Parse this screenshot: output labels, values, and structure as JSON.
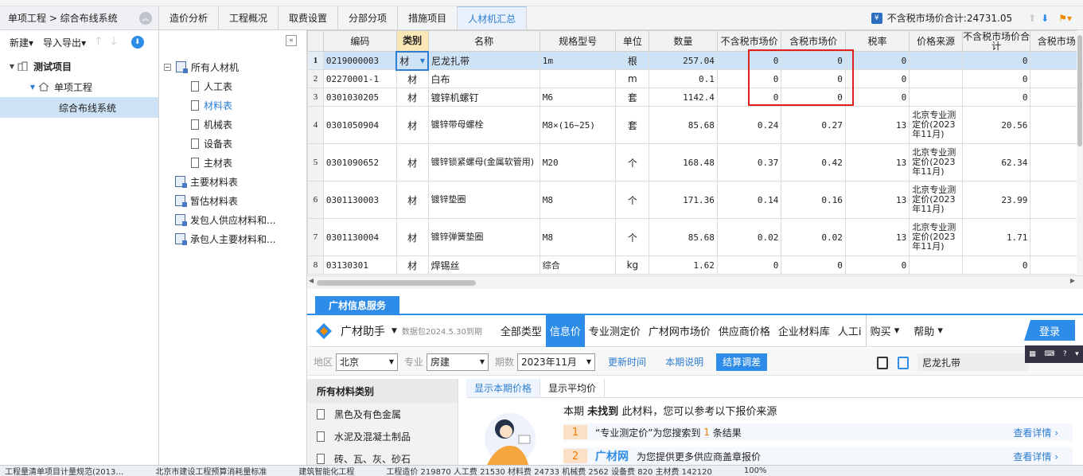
{
  "left_panel": {
    "title": "单项工程 > 综合布线系统",
    "new_label": "新建",
    "import_export_label": "导入导出",
    "tree": [
      {
        "label": "测试项目"
      },
      {
        "label": "单项工程"
      },
      {
        "label": "综合布线系统"
      }
    ]
  },
  "tabs": [
    "造价分析",
    "工程概况",
    "取费设置",
    "分部分项",
    "措施项目",
    "人材机汇总"
  ],
  "summary": "不含税市场价合计:24731.05",
  "mid_tree": [
    {
      "label": "所有人材机",
      "type": "folder"
    },
    {
      "label": "人工表",
      "type": "doc"
    },
    {
      "label": "材料表",
      "type": "doc",
      "selected": true
    },
    {
      "label": "机械表",
      "type": "doc"
    },
    {
      "label": "设备表",
      "type": "doc"
    },
    {
      "label": "主材表",
      "type": "doc"
    },
    {
      "label": "主要材料表",
      "type": "folder"
    },
    {
      "label": "暂估材料表",
      "type": "folder"
    },
    {
      "label": "发包人供应材料和...",
      "type": "folder"
    },
    {
      "label": "承包人主要材料和...",
      "type": "folder"
    }
  ],
  "grid": {
    "headers": [
      "编码",
      "类别",
      "名称",
      "规格型号",
      "单位",
      "数量",
      "不含税市场价",
      "含税市场价",
      "税率",
      "价格来源",
      "不含税市场价合计",
      "含税市场"
    ],
    "rows": [
      {
        "no": "1",
        "code": "0219000003",
        "cat": "材",
        "name": "尼龙扎带",
        "spec": "1m",
        "unit": "根",
        "qty": "257.04",
        "p_ex": "0",
        "p_in": "0",
        "tax": "0",
        "src": "",
        "total": "0"
      },
      {
        "no": "2",
        "code": "02270001-1",
        "cat": "材",
        "name": "白布",
        "spec": "",
        "unit": "m",
        "qty": "0.1",
        "p_ex": "0",
        "p_in": "0",
        "tax": "0",
        "src": "",
        "total": "0"
      },
      {
        "no": "3",
        "code": "0301030205",
        "cat": "材",
        "name": "镀锌机螺钉",
        "spec": "M6",
        "unit": "套",
        "qty": "1142.4",
        "p_ex": "0",
        "p_in": "0",
        "tax": "0",
        "src": "",
        "total": "0"
      },
      {
        "no": "4",
        "code": "0301050904",
        "cat": "材",
        "name": "镀锌带母螺栓",
        "spec": "M8×(16~25)",
        "unit": "套",
        "qty": "85.68",
        "p_ex": "0.24",
        "p_in": "0.27",
        "tax": "13",
        "src": "北京专业测定价(2023年11月)",
        "total": "20.56"
      },
      {
        "no": "5",
        "code": "0301090652",
        "cat": "材",
        "name": "镀锌锁紧螺母(金属软管用)",
        "spec": "M20",
        "unit": "个",
        "qty": "168.48",
        "p_ex": "0.37",
        "p_in": "0.42",
        "tax": "13",
        "src": "北京专业测定价(2023年11月)",
        "total": "62.34"
      },
      {
        "no": "6",
        "code": "0301130003",
        "cat": "材",
        "name": "镀锌垫圈",
        "spec": "M8",
        "unit": "个",
        "qty": "171.36",
        "p_ex": "0.14",
        "p_in": "0.16",
        "tax": "13",
        "src": "北京专业测定价(2023年11月)",
        "total": "23.99"
      },
      {
        "no": "7",
        "code": "0301130004",
        "cat": "材",
        "name": "镀锌弹簧垫圈",
        "spec": "M8",
        "unit": "个",
        "qty": "85.68",
        "p_ex": "0.02",
        "p_in": "0.02",
        "tax": "13",
        "src": "北京专业测定价(2023年11月)",
        "total": "1.71"
      },
      {
        "no": "8",
        "code": "03130301",
        "cat": "材",
        "name": "焊锡丝",
        "spec": "综合",
        "unit": "kg",
        "qty": "1.62",
        "p_ex": "0",
        "p_in": "0",
        "tax": "0",
        "src": "",
        "total": "0"
      }
    ]
  },
  "guangcai": {
    "tab": "广材信息服务",
    "title": "广材助手",
    "version": "数据包2024.5.30到期",
    "nav": [
      "全部类型",
      "信息价",
      "专业测定价",
      "广材网市场价",
      "供应商价格",
      "企业材料库",
      "人工i",
      "购买",
      "帮助"
    ],
    "login": "登录",
    "filter": {
      "region_label": "地区",
      "region": "北京",
      "major_label": "专业",
      "major": "房建",
      "period_label": "期数",
      "period": "2023年11月",
      "btn_update": "更新时间",
      "btn_note": "本期说明",
      "btn_adjust": "结算调差"
    },
    "search_value": "尼龙扎带",
    "categories_title": "所有材料类别",
    "categories": [
      "黑色及有色金属",
      "水泥及混凝土制品",
      "砖、瓦、灰、砂石"
    ],
    "price_tabs": [
      "显示本期价格",
      "显示平均价"
    ],
    "msg_pre": "本期",
    "msg_bold": "未找到",
    "msg_post": "此材料，您可以参考以下报价来源",
    "results": [
      {
        "num": "1",
        "pre": "“专业测定价”为您搜索到",
        "count": "1",
        "post": "条结果",
        "detail": "查看详情 ›"
      },
      {
        "num": "2",
        "brand": "广材网",
        "post": "为您提供更多供应商盖章报价",
        "detail": "查看详情 ›"
      }
    ]
  },
  "statusbar": [
    "工程量清单项目计量规范(2013…",
    "北京市建设工程预算消耗量标准",
    "建筑智能化工程",
    "工程造价 219870 人工费 21530 材料费 24733 机械费 2562 设备费 820 主材费 142120",
    "100%"
  ]
}
